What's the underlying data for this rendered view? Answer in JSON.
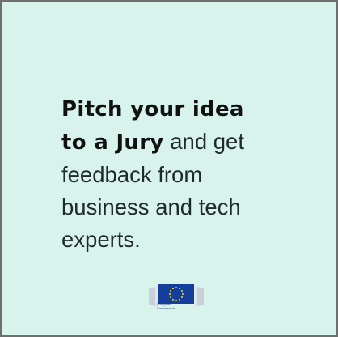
{
  "headline": {
    "bold_line1": "Pitch your idea",
    "bold_line2": "to a Jury",
    "tail_line2": " and get",
    "line3": "feedback from",
    "line4": "business and tech",
    "line5": "experts."
  },
  "logo": {
    "name": "European Commission logo",
    "label_line1": "European",
    "label_line2": "Commission"
  },
  "colors": {
    "background": "#d8f3ec",
    "border": "#6f6f6f",
    "eu_blue": "#143e9b",
    "eu_star": "#ffd617"
  }
}
